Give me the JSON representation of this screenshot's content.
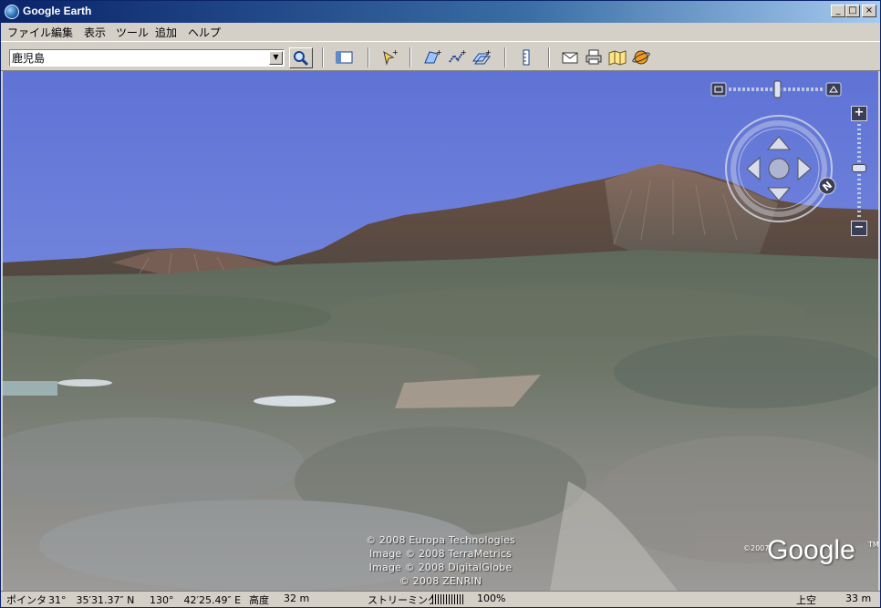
{
  "window": {
    "title": "Google Earth",
    "controls": {
      "minimize": "_",
      "maximize": "□",
      "close": "×"
    }
  },
  "menu": [
    {
      "label": "ファイル"
    },
    {
      "label": "編集"
    },
    {
      "label": "表示"
    },
    {
      "label": "ツール"
    },
    {
      "label": "追加"
    },
    {
      "label": "ヘルプ"
    }
  ],
  "toolbar": {
    "search_value": "鹿児島",
    "buttons": [
      {
        "name": "sidebar-toggle-icon"
      },
      {
        "name": "placemark-icon"
      },
      {
        "name": "polygon-icon"
      },
      {
        "name": "path-icon"
      },
      {
        "name": "image-overlay-icon"
      },
      {
        "name": "ruler-icon"
      },
      {
        "name": "email-icon"
      },
      {
        "name": "print-icon"
      },
      {
        "name": "google-maps-icon"
      },
      {
        "name": "sky-icon"
      }
    ]
  },
  "navigation": {
    "zoom_in": "+",
    "zoom_out": "−",
    "compass": "N"
  },
  "attribution": [
    "© 2008 Europa Technologies",
    "Image © 2008 TerraMetrics",
    "Image © 2008 DigitalGlobe",
    "© 2008 ZENRIN"
  ],
  "logo": {
    "copyright": "©2007",
    "word": "Google",
    "tm": "TM"
  },
  "status": {
    "pointer_label": "ポインタ",
    "lat": "31°　35′31.37″ N",
    "lon": "130°　42′25.49″ E",
    "elev_label": "高度",
    "elev_value": "32 m",
    "streaming_label": "ストリーミング",
    "streaming_percent": "100%",
    "eye_label": "上空",
    "eye_value": "33 m"
  },
  "colors": {
    "sky": "#6b80dc",
    "title_bar": "#0a246a",
    "chrome": "#d4d0c8"
  }
}
